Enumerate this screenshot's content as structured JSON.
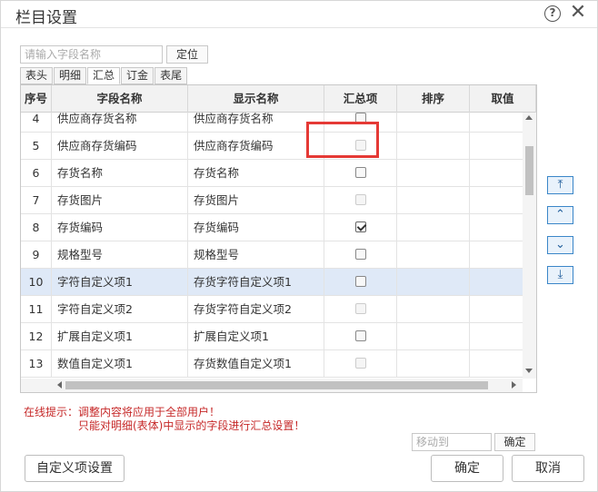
{
  "title": "栏目设置",
  "icons": {
    "help": "help-circle-icon",
    "close": "close-icon"
  },
  "search": {
    "placeholder": "请输入字段名称",
    "value": "",
    "locate_label": "定位"
  },
  "tabs": [
    {
      "label": "表头",
      "active": false
    },
    {
      "label": "明细",
      "active": false
    },
    {
      "label": "汇总",
      "active": true
    },
    {
      "label": "订金",
      "active": false
    },
    {
      "label": "表尾",
      "active": false
    }
  ],
  "columns": [
    "序号",
    "字段名称",
    "显示名称",
    "汇总项",
    "排序",
    "取值"
  ],
  "rows": [
    {
      "no": "4",
      "field": "供应商存货名称",
      "display": "供应商存货名称",
      "sum": "enabled",
      "checked": false
    },
    {
      "no": "5",
      "field": "供应商存货编码",
      "display": "供应商存货编码",
      "sum": "disabled",
      "checked": false
    },
    {
      "no": "6",
      "field": "存货名称",
      "display": "存货名称",
      "sum": "enabled",
      "checked": false
    },
    {
      "no": "7",
      "field": "存货图片",
      "display": "存货图片",
      "sum": "disabled",
      "checked": false
    },
    {
      "no": "8",
      "field": "存货编码",
      "display": "存货编码",
      "sum": "enabled",
      "checked": true
    },
    {
      "no": "9",
      "field": "规格型号",
      "display": "规格型号",
      "sum": "enabled",
      "checked": false
    },
    {
      "no": "10",
      "field": "字符自定义项1",
      "display": "存货字符自定义项1",
      "sum": "enabled",
      "checked": false,
      "selected": true
    },
    {
      "no": "11",
      "field": "字符自定义项2",
      "display": "存货字符自定义项2",
      "sum": "disabled",
      "checked": false
    },
    {
      "no": "12",
      "field": "扩展自定义项1",
      "display": "扩展自定义项1",
      "sum": "enabled",
      "checked": false
    },
    {
      "no": "13",
      "field": "数值自定义项1",
      "display": "存货数值自定义项1",
      "sum": "disabled",
      "checked": false
    }
  ],
  "move_buttons": [
    {
      "name": "move-top-button",
      "glyph": "⤒"
    },
    {
      "name": "move-up-button",
      "glyph": "⌃"
    },
    {
      "name": "move-down-button",
      "glyph": "⌄"
    },
    {
      "name": "move-bottom-button",
      "glyph": "⤓"
    }
  ],
  "tips": {
    "line1": "在线提示：调整内容将应用于全部用户！",
    "line2": "只能对明细(表体)中显示的字段进行汇总设置！"
  },
  "moveto": {
    "placeholder": "移动到",
    "confirm_label": "确定"
  },
  "buttons": {
    "custom_label": "自定义项设置",
    "ok_label": "确定",
    "cancel_label": "取消"
  },
  "colors": {
    "highlight": "#e53935",
    "selected_row": "#dfe9f7",
    "tip_text": "#c62828",
    "move_button_border": "#3a86c8"
  }
}
